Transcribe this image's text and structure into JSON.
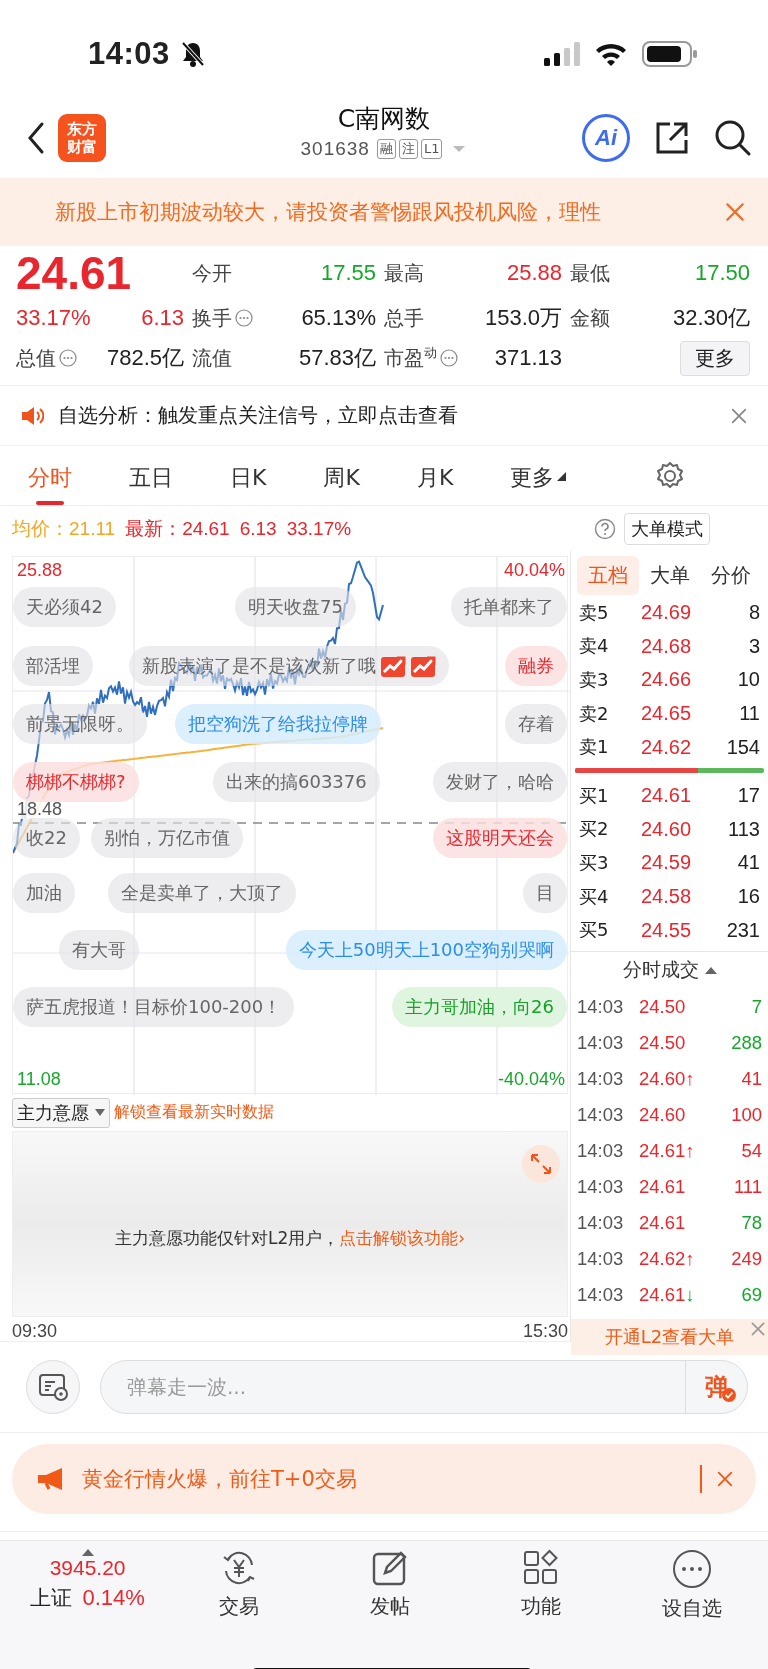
{
  "status_bar": {
    "time": "14:03"
  },
  "header": {
    "logo": [
      "东方",
      "财富"
    ],
    "title": "C南网数",
    "code": "301638",
    "badges": [
      "融",
      "注",
      "L1"
    ],
    "ai": "Ai"
  },
  "notice": {
    "text": "新股上市初期波动较大，请投资者警惕跟风投机风险，理性"
  },
  "quote": {
    "price": "24.61",
    "change_pct": "33.17%",
    "change": "6.13",
    "more": "更多",
    "color": "#e8262d",
    "stats": [
      {
        "label": "今开",
        "value": "17.55",
        "color": "#15a62a",
        "info": false
      },
      {
        "label": "最高",
        "value": "25.88",
        "color": "#e8262d",
        "info": false
      },
      {
        "label": "最低",
        "value": "17.50",
        "color": "#15a62a",
        "info": false
      },
      {
        "label": "换手",
        "value": "65.13%",
        "color": "#222222",
        "info": true
      },
      {
        "label": "总手",
        "value": "153.0万",
        "color": "#222222",
        "info": false
      },
      {
        "label": "金额",
        "value": "32.30亿",
        "color": "#222222",
        "info": false
      },
      {
        "label": "总值",
        "value": "782.5亿",
        "color": "#222222",
        "info": true
      },
      {
        "label": "流值",
        "value": "57.83亿",
        "color": "#222222",
        "info": false
      },
      {
        "label": "市盈$^{动}$",
        "value": "371.13",
        "color": "#222222",
        "info": true
      }
    ]
  },
  "alert": {
    "text": "自选分析：触发重点关注信号，立即点击查看"
  },
  "tabs": [
    {
      "label": "分时",
      "selected": true,
      "menu": false
    },
    {
      "label": "五日",
      "selected": false,
      "menu": false
    },
    {
      "label": "日K",
      "selected": false,
      "menu": false
    },
    {
      "label": "周K",
      "selected": false,
      "menu": false
    },
    {
      "label": "月K",
      "selected": false,
      "menu": false
    },
    {
      "label": "更多",
      "selected": false,
      "menu": true
    }
  ],
  "chart": {
    "avg_label": "均价：",
    "avg": "21.11",
    "last_label": "最新：",
    "last": "24.61",
    "change": "6.13",
    "change_pct": "33.17%",
    "mode_button": "大单模式",
    "high": "25.88",
    "high_pct": "40.04%",
    "low": "11.08",
    "low_pct": "-40.04%",
    "prev_close": "18.48",
    "start": "09:30",
    "end": "15:30"
  },
  "danmaku_rows": [
    [
      {
        "text": "天必须42",
        "kind": "gray"
      },
      {
        "text": "明天收盘75",
        "kind": "gray"
      },
      {
        "text": "托单都来了",
        "kind": "gray"
      }
    ],
    [
      {
        "text": "部活埋",
        "kind": "gray"
      },
      {
        "text": "新股表演了是不是该次新了哦",
        "kind": "hot"
      },
      {
        "text": "融券",
        "kind": "red"
      }
    ],
    [
      {
        "text": "前景无限呀。",
        "kind": "gray"
      },
      {
        "text": "把空狗洗了给我拉停牌",
        "kind": "blue"
      },
      {
        "text": "存着",
        "kind": "gray"
      }
    ],
    [
      {
        "text": "梆梆不梆梆?",
        "kind": "red"
      },
      {
        "text": "出来的搞603376",
        "kind": "gray"
      },
      {
        "text": "发财了，哈哈",
        "kind": "gray"
      }
    ],
    [
      {
        "text": "收22",
        "kind": "gray"
      },
      {
        "text": "别怕，万亿市值",
        "kind": "gray"
      },
      {
        "text": "这股明天还会",
        "kind": "red"
      }
    ],
    [
      {
        "text": "加油",
        "kind": "gray"
      },
      {
        "text": "全是卖单了，大顶了",
        "kind": "gray"
      },
      {
        "text": "目",
        "kind": "gray"
      }
    ],
    [
      {
        "text": "有大哥",
        "kind": "gray"
      },
      {
        "text": "今天上50明天上100空狗别哭啊",
        "kind": "blue"
      }
    ],
    [
      {
        "text": "萨五虎报道！目标价100-200！",
        "kind": "gray"
      },
      {
        "text": "主力哥加油，向26",
        "kind": "green"
      }
    ]
  ],
  "indicator": {
    "name": "主力意愿",
    "link": "解锁查看最新实时数据",
    "message": "主力意愿功能仅针对L2用户，",
    "message_link": "点击解锁该功能›"
  },
  "book": {
    "tabs": [
      {
        "label": "五档",
        "selected": true
      },
      {
        "label": "大单",
        "selected": false
      },
      {
        "label": "分价",
        "selected": false
      }
    ],
    "asks": [
      {
        "label": "卖5",
        "price": "24.69",
        "volume": "8"
      },
      {
        "label": "卖4",
        "price": "24.68",
        "volume": "3"
      },
      {
        "label": "卖3",
        "price": "24.66",
        "volume": "10"
      },
      {
        "label": "卖2",
        "price": "24.65",
        "volume": "11"
      },
      {
        "label": "卖1",
        "price": "24.62",
        "volume": "154"
      }
    ],
    "ratio": {
      "level": 0.65
    },
    "bids": [
      {
        "label": "买1",
        "price": "24.61",
        "volume": "17"
      },
      {
        "label": "买2",
        "price": "24.60",
        "volume": "113"
      },
      {
        "label": "买3",
        "price": "24.59",
        "volume": "41"
      },
      {
        "label": "买4",
        "price": "24.58",
        "volume": "16"
      },
      {
        "label": "买5",
        "price": "24.55",
        "volume": "231"
      }
    ],
    "trades_title": "分时成交",
    "trades": [
      {
        "time": "14:03",
        "price": "24.50",
        "color": "#15a62a",
        "volume": "7"
      },
      {
        "time": "14:03",
        "price": "24.50",
        "color": "#15a62a",
        "volume": "288"
      },
      {
        "time": "14:03",
        "price": "24.60",
        "arrow": "↑",
        "color": "#e8262d",
        "volume": "41"
      },
      {
        "time": "14:03",
        "price": "24.60",
        "color": "#e8262d",
        "volume": "100"
      },
      {
        "time": "14:03",
        "price": "24.61",
        "arrow": "↑",
        "color": "#e8262d",
        "volume": "54"
      },
      {
        "time": "14:03",
        "price": "24.61",
        "color": "#e8262d",
        "volume": "111"
      },
      {
        "time": "14:03",
        "price": "24.61",
        "color": "#15a62a",
        "volume": "78"
      },
      {
        "time": "14:03",
        "price": "24.62",
        "arrow": "↑",
        "color": "#e8262d",
        "volume": "249"
      },
      {
        "time": "14:03",
        "price": "24.61",
        "arrow": "↓",
        "color": "#15a62a",
        "volume": "69"
      }
    ],
    "promo": "开通L2查看大单"
  },
  "comment": {
    "placeholder": "弹幕走一波...",
    "send": "弹"
  },
  "banner": {
    "text": "黄金行情火爆，前往T+0交易"
  },
  "nav": {
    "index_value": "3945.20",
    "index_name": "上证",
    "index_change": "0.14%",
    "items": [
      {
        "label": "交易",
        "kind": "trade"
      },
      {
        "label": "发帖",
        "kind": "post"
      },
      {
        "label": "功能",
        "kind": "apps"
      },
      {
        "label": "设自选",
        "kind": "more"
      }
    ]
  }
}
